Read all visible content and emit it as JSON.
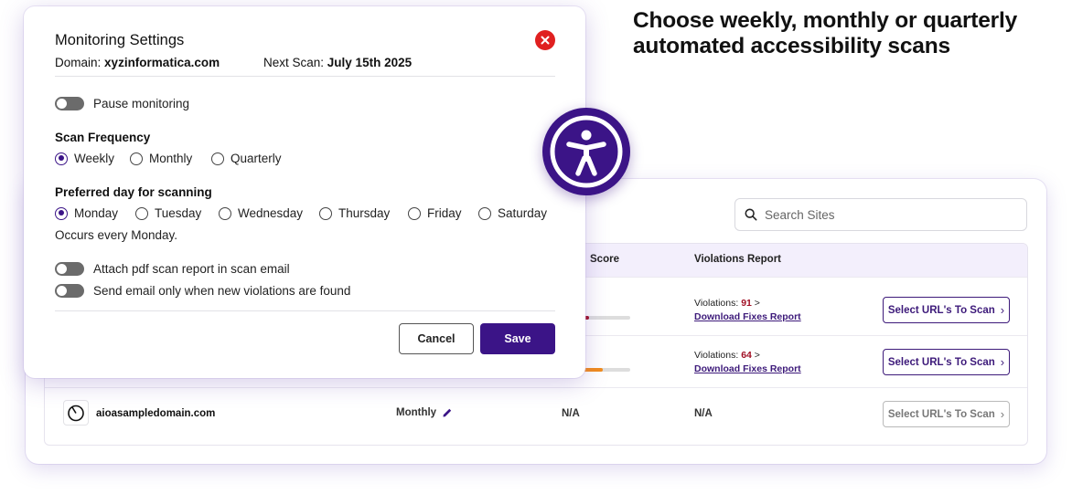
{
  "headline": {
    "line1": "Choose weekly, monthly or quarterly",
    "line2": "automated accessibility scans"
  },
  "colors": {
    "brand": "#3b1487",
    "close": "#e02020",
    "violation": "#a10f24"
  },
  "modal": {
    "title": "Monitoring Settings",
    "domain_label": "Domain:",
    "domain_value": "xyzinformatica.com",
    "next_scan_label": "Next Scan:",
    "next_scan_value": "July 15th 2025",
    "pause_label": "Pause monitoring",
    "frequency_heading": "Scan Frequency",
    "frequency_options": [
      "Weekly",
      "Monthly",
      "Quarterly"
    ],
    "frequency_selected": "Weekly",
    "day_heading": "Preferred day for scanning",
    "day_options": [
      "Monday",
      "Tuesday",
      "Wednesday",
      "Thursday",
      "Friday",
      "Saturday"
    ],
    "day_selected": "Monday",
    "day_note": "Occurs every Monday.",
    "attach_pdf_label": "Attach pdf scan report in scan email",
    "email_only_label": "Send email only when new violations are found",
    "cancel_label": "Cancel",
    "save_label": "Save"
  },
  "dashboard": {
    "search_placeholder": "Search Sites",
    "columns": {
      "score": "Score",
      "violations": "Violations Report"
    },
    "violations_label": "Violations:",
    "download_label": "Download Fixes Report",
    "select_label": "Select URL's To Scan",
    "rows": [
      {
        "violations": "91",
        "score_fraction": 0.17,
        "score_color": "#a10f24"
      },
      {
        "violations": "64",
        "score_fraction": 0.45,
        "score_color": "#f28c1c"
      },
      {
        "domain": "aioasampledomain.com",
        "frequency": "Monthly",
        "score": "N/A",
        "violations": "N/A"
      }
    ]
  }
}
